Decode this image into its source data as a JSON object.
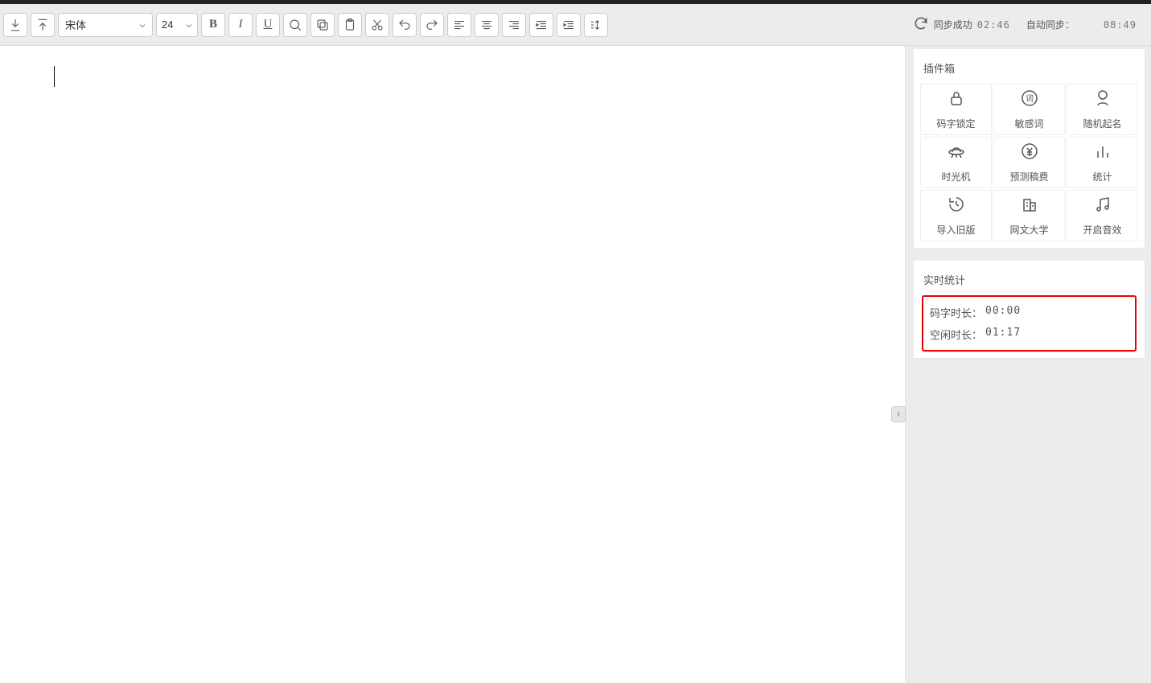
{
  "toolbar": {
    "font_family": "宋体",
    "font_size": "24"
  },
  "sync": {
    "status_label": "同步成功",
    "last_sync_time": "02:46",
    "auto_sync_label": "自动同步：",
    "clock_time": "08:49"
  },
  "plugins": {
    "title": "插件箱",
    "items": [
      {
        "label": "码字锁定"
      },
      {
        "label": "敏感词"
      },
      {
        "label": "随机起名"
      },
      {
        "label": "时光机"
      },
      {
        "label": "预测稿费"
      },
      {
        "label": "统计"
      },
      {
        "label": "导入旧版"
      },
      {
        "label": "网文大学"
      },
      {
        "label": "开启音效"
      }
    ]
  },
  "stats": {
    "title": "实时统计",
    "typing_label": "码字时长：",
    "typing_value": "00:00",
    "idle_label": "空闲时长：",
    "idle_value": "01:17"
  }
}
